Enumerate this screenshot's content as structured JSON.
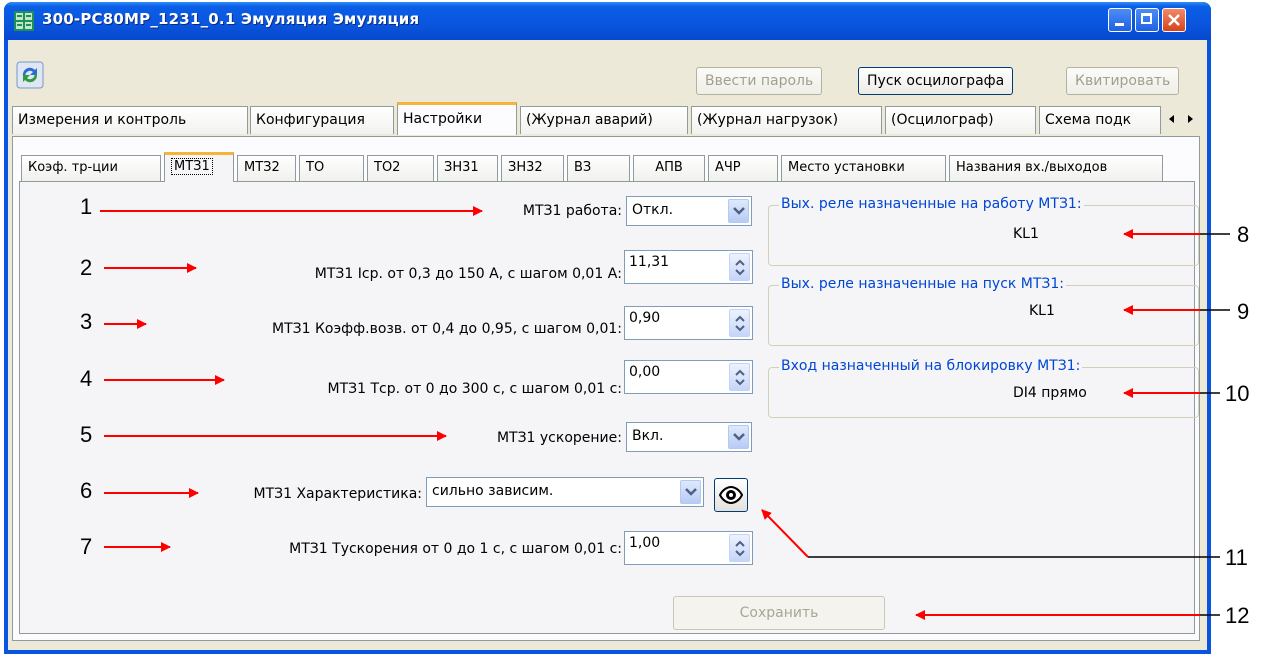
{
  "window": {
    "title": "300-PC80MP_1231_0.1 Эмуляция Эмуляция"
  },
  "toolbar": {
    "password_label": "Ввести пароль",
    "oscillograph_label": "Пуск осцилографа",
    "ack_label": "Квитировать"
  },
  "main_tabs": [
    "Измерения и контроль",
    "Конфигурация",
    "Настройки",
    "(Журнал аварий)",
    "(Журнал нагрузок)",
    "(Осцилограф)",
    "Схема подк"
  ],
  "main_tabs_selected": "Настройки",
  "sub_tabs": [
    "Коэф. тр-ции",
    "МТЗ1",
    "МТЗ2",
    "ТО",
    "ТО2",
    "ЗН31",
    "ЗН32",
    "ВЗ",
    "АПВ",
    "АЧР",
    "Место установки",
    "Названия вх./выходов"
  ],
  "sub_tabs_selected": "МТЗ1",
  "form": {
    "work_label": "МТЗ1 работа:",
    "work_value": "Откл.",
    "icp_label": "МТЗ1 Iср. от 0,3 до 150 А, с шагом 0,01 А:",
    "icp_value": "11,31",
    "koef_label": "МТЗ1 Коэфф.возв. от 0,4 до 0,95, с шагом 0,01:",
    "koef_value": "0,90",
    "tcp_label": "МТЗ1 Тср. от 0 до 300 с, с шагом 0,01 с:",
    "tcp_value": "0,00",
    "accel_label": "МТЗ1 ускорение:",
    "accel_value": "Вкл.",
    "char_label": "МТЗ1 Характеристика:",
    "char_value": "сильно зависим.",
    "taccel_label": "МТЗ1 Тускорения  от 0 до 1 с, с шагом 0,01 с:",
    "taccel_value": "1,00"
  },
  "groups": {
    "work_relay_caption": "Вых. реле назначенные на работу МТЗ1:",
    "work_relay_value": "KL1",
    "start_relay_caption": "Вых. реле назначенные на пуск МТЗ1:",
    "start_relay_value": "KL1",
    "block_input_caption": "Вход назначенный на блокировку МТЗ1:",
    "block_input_value": "DI4 прямо"
  },
  "save_label": "Сохранить",
  "annotations": [
    "1",
    "2",
    "3",
    "4",
    "5",
    "6",
    "7",
    "8",
    "9",
    "10",
    "11",
    "12"
  ],
  "colors": {
    "titlebar": "#0a55de",
    "arrow": "#ff0000",
    "caption_blue": "#0046d5",
    "tab_highlight": "#f5b43a",
    "panel_bg": "#f5f5f7"
  },
  "icons": [
    "app-icon",
    "refresh-icon",
    "minimize-icon",
    "maximize-icon",
    "close-icon",
    "chevron-down-icon",
    "spin-icon",
    "eye-icon",
    "scroll-left-icon",
    "scroll-right-icon"
  ]
}
